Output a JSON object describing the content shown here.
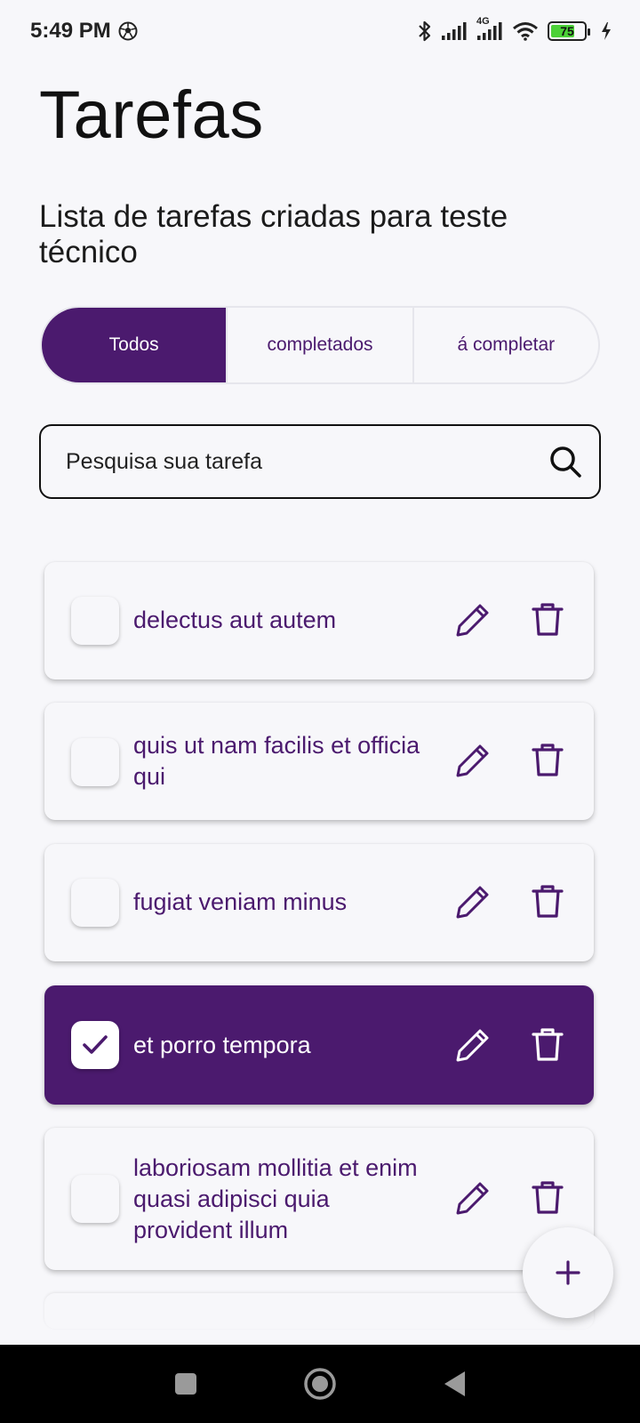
{
  "status_bar": {
    "time": "5:49 PM",
    "network": "4G",
    "battery_level": 75,
    "battery_label": "75",
    "icons": [
      "soccer-ball-icon",
      "bluetooth-icon",
      "signal-icon",
      "wifi-icon",
      "battery-icon",
      "charging-icon"
    ]
  },
  "header": {
    "title": "Tarefas",
    "subtitle": "Lista de tarefas criadas para teste técnico"
  },
  "filter": {
    "tabs": [
      {
        "label": "Todos",
        "active": true
      },
      {
        "label": "completados",
        "active": false
      },
      {
        "label": "á completar",
        "active": false
      }
    ]
  },
  "search": {
    "placeholder": "Pesquisa sua tarefa",
    "value": ""
  },
  "tasks": [
    {
      "title": "delectus aut autem",
      "completed": false
    },
    {
      "title": "quis ut nam facilis et officia qui",
      "completed": false
    },
    {
      "title": "fugiat veniam minus",
      "completed": false
    },
    {
      "title": "et porro tempora",
      "completed": true
    },
    {
      "title": "laboriosam mollitia et enim quasi adipisci quia provident illum",
      "completed": false
    }
  ],
  "colors": {
    "accent": "#4b1a6e",
    "background": "#f7f7fa",
    "battery": "#4cd137"
  }
}
